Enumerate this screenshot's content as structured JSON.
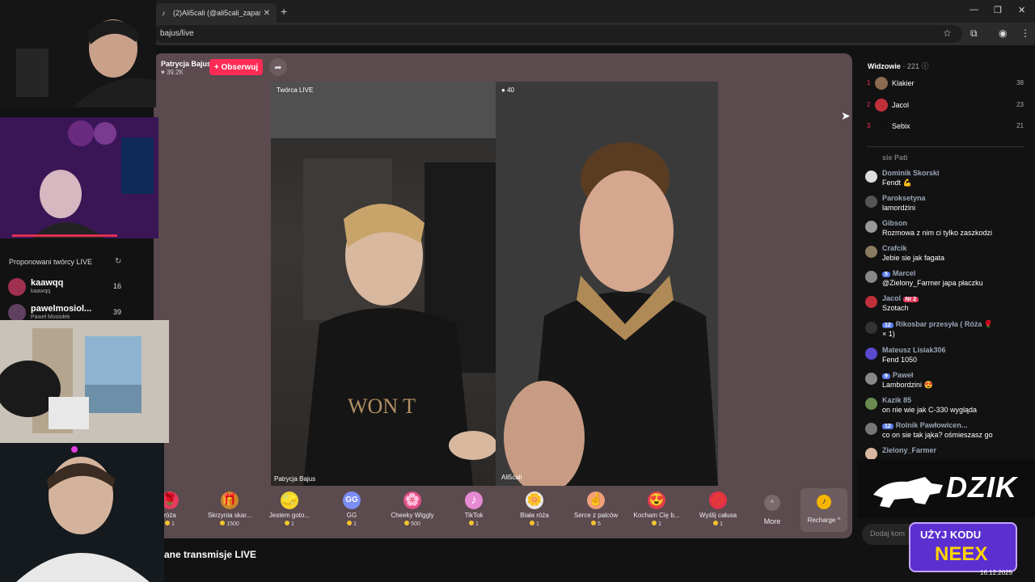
{
  "browser": {
    "tab_title": "(2)Ali5cali (@ali5cali_zapasowe",
    "tab_close": "✕",
    "new_tab": "+",
    "url": "bajus/live"
  },
  "host": {
    "name": "Patrycja Bajus",
    "likes": "39.2K",
    "follow_label": "+ Obserwuj"
  },
  "stream": {
    "left_label_top": "Twórca LIVE",
    "left_label_bottom": "Patrycja Bajus",
    "right_label_top": "40",
    "right_label_bottom": "Ali5cali"
  },
  "gifts": [
    {
      "name": "róża",
      "price": "1",
      "icon": "rose-icon",
      "color": "#e33b5c",
      "glyph": "🌹"
    },
    {
      "name": "Skrzynia skar...",
      "price": "1500",
      "icon": "treasure-chest-icon",
      "color": "#c9862a",
      "glyph": "🎁"
    },
    {
      "name": "Jestem goto...",
      "price": "1",
      "icon": "sponge-icon",
      "color": "#f2d32a",
      "glyph": "🧽"
    },
    {
      "name": "GG",
      "price": "1",
      "icon": "gg-icon",
      "color": "#7b8cf5",
      "glyph": "GG"
    },
    {
      "name": "Cheeky Wiggly",
      "price": "500",
      "icon": "wiggly-icon",
      "color": "#e0508a",
      "glyph": "🌸"
    },
    {
      "name": "TikTok",
      "price": "1",
      "icon": "tiktok-icon",
      "color": "#e58ad3",
      "glyph": "♪"
    },
    {
      "name": "Biała róża",
      "price": "1",
      "icon": "white-rose-icon",
      "color": "#e8e8e8",
      "glyph": "🌼"
    },
    {
      "name": "Serce z palców",
      "price": "5",
      "icon": "finger-heart-icon",
      "color": "#f0a07a",
      "glyph": "🤞"
    },
    {
      "name": "Kocham Cię b...",
      "price": "1",
      "icon": "love-icon",
      "color": "#e63c4c",
      "glyph": "😍"
    },
    {
      "name": "Wyślij całusa",
      "price": "1",
      "icon": "kiss-icon",
      "color": "#e0304a",
      "glyph": "💋"
    }
  ],
  "more_label": "More",
  "more_chevron": "^",
  "recharge_label": "Recharge ^",
  "recharge_glyph": "♪",
  "section_title": "ane transmisje LIVE",
  "suggested": {
    "title": "Proponowani twórcy LIVE",
    "creators": [
      {
        "name": "kaawqq",
        "sub": "kaawqq",
        "count": "16"
      },
      {
        "name": "pawelmosiol...",
        "sub": "Paweł Mosiołek",
        "count": "39"
      }
    ]
  },
  "viewers": {
    "title": "Widzowie",
    "count": "· 221",
    "list": [
      {
        "rank": "1",
        "name": "Klakier",
        "score": "38",
        "color": "#8a6a50"
      },
      {
        "rank": "2",
        "name": "Jacol",
        "score": "23",
        "color": "#c0303a"
      },
      {
        "rank": "3",
        "name": "Sebix",
        "score": "21",
        "color": "#111111"
      }
    ]
  },
  "comments": [
    {
      "user": "sie Pati",
      "badge": "",
      "text": ""
    },
    {
      "user": "Dominik Skorski",
      "badge": "",
      "text": "Fendt 💪"
    },
    {
      "user": "Paroksetyna",
      "badge": "",
      "text": "lamordżini"
    },
    {
      "user": "Gibson",
      "badge": "",
      "text": "Rozmowa z nim ci tylko zaszkodzi"
    },
    {
      "user": "Crafcik",
      "badge": "",
      "text": "Jebie sie jak fagata"
    },
    {
      "user": "Marcel",
      "badge": "5",
      "text": "@Zielony_Farmer japa płaczku"
    },
    {
      "user": "Jacol",
      "badge": "Nr 2",
      "text": "Szotach"
    },
    {
      "user": "Rikosbar przesyła ( Róża 🌹",
      "badge": "12",
      "text": "× 1)"
    },
    {
      "user": "Mateusz Lisiak306",
      "badge": "",
      "text": "Fend 1050"
    },
    {
      "user": "Paweł",
      "badge": "9",
      "text": "Lambordzini 😍"
    },
    {
      "user": "Kazik 85",
      "badge": "",
      "text": "on nie wie jak C-330 wygląda"
    },
    {
      "user": "Rolnik Pawłowicen...",
      "badge": "12",
      "text": "co on sie tak jąka? ośmieszasz go"
    },
    {
      "user": "Zielony_Farmer",
      "badge": "",
      "text": ""
    }
  ],
  "chat_placeholder": "Dodaj kom",
  "sponsor": {
    "brand": "DZIK",
    "promo_line1": "UŻYJ KODU",
    "promo_line2": "NEEX"
  },
  "date": "16.12.2025"
}
